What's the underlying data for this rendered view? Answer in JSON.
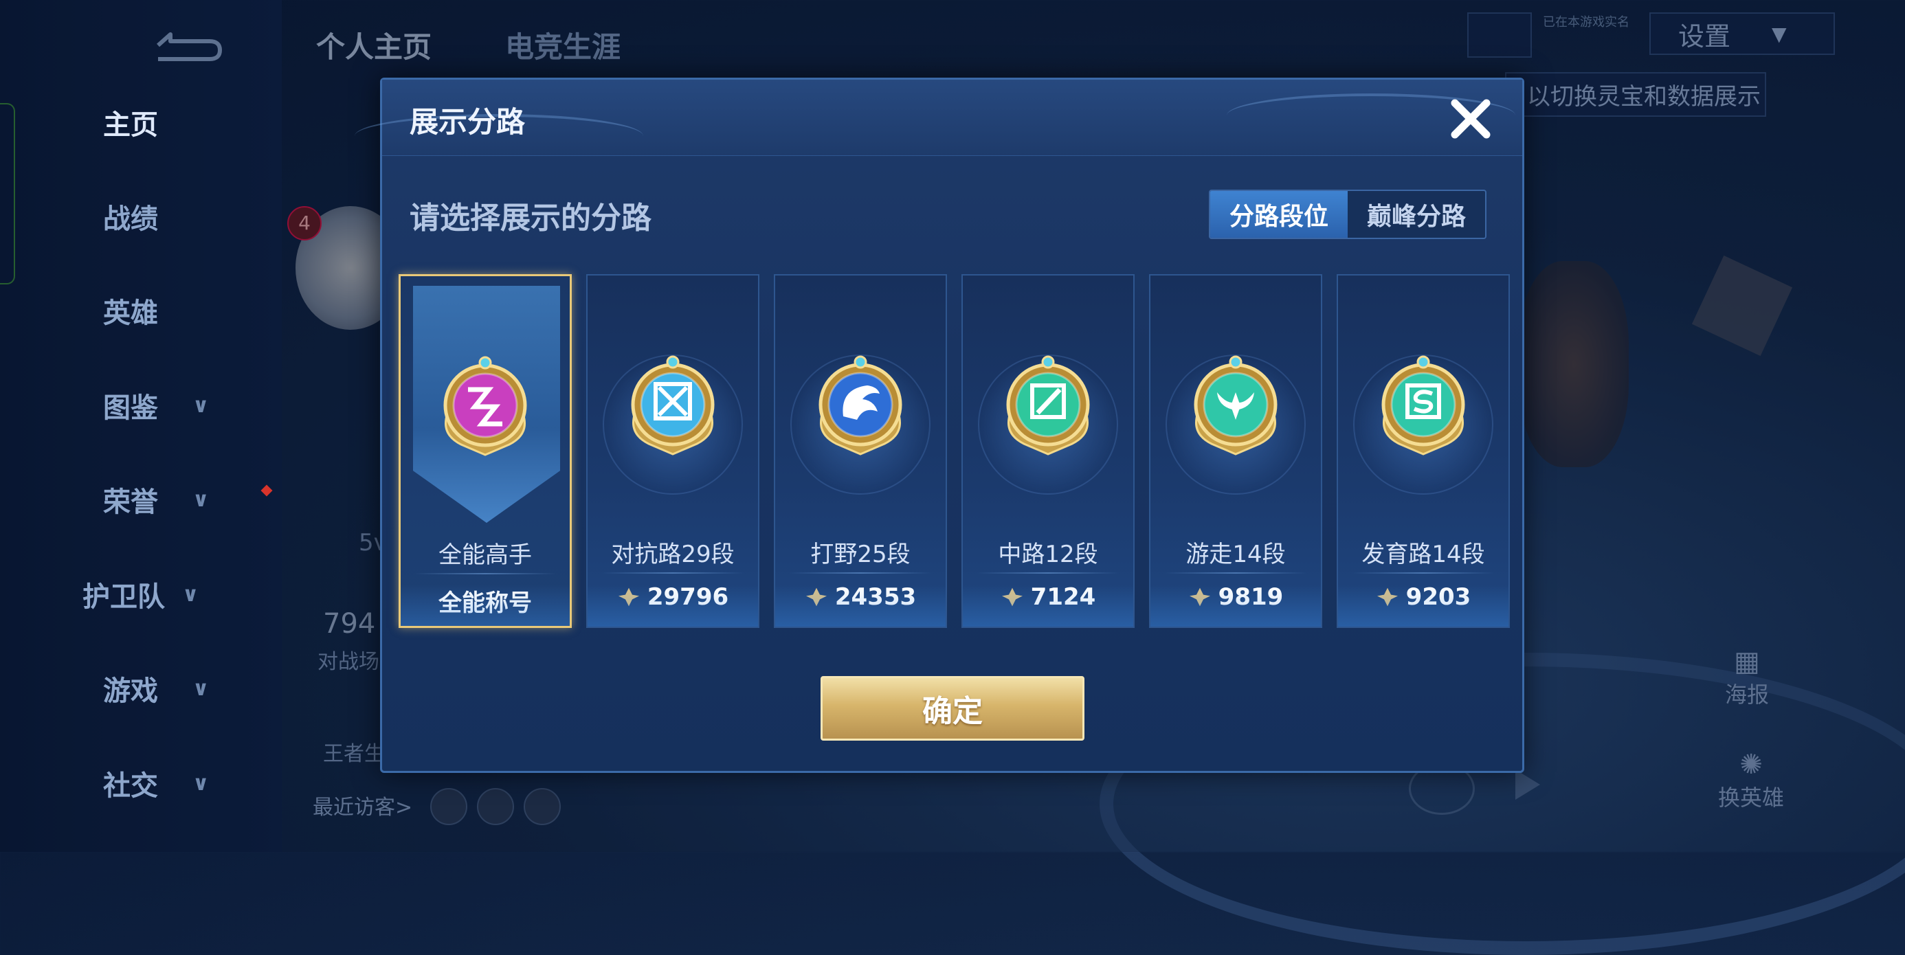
{
  "background": {
    "top_tabs": [
      "个人主页",
      "电竞生涯"
    ],
    "sidebar": [
      {
        "label": "主页",
        "has_arrow": false
      },
      {
        "label": "战绩",
        "has_arrow": false
      },
      {
        "label": "英雄",
        "has_arrow": false
      },
      {
        "label": "图鉴",
        "has_arrow": true
      },
      {
        "label": "荣誉",
        "has_arrow": true
      },
      {
        "label": "护卫队",
        "has_arrow": true
      },
      {
        "label": "游戏",
        "has_arrow": true
      },
      {
        "label": "社交",
        "has_arrow": true
      }
    ],
    "settings_label": "设置",
    "hint_text": "以切换灵宝和数据展示",
    "tiny_note": "已在本游戏实名",
    "badge_count": "4",
    "partial_5v": "5v",
    "partial_number": "794",
    "partial_battle": "对战场",
    "partial_king": "王者生",
    "recent_visitors": "最近访客>",
    "poster": "海报",
    "change_hero": "换英雄"
  },
  "modal": {
    "title": "展示分路",
    "subtitle": "请选择展示的分路",
    "tabs": [
      {
        "label": "分路段位",
        "active": true
      },
      {
        "label": "巅峰分路",
        "active": false
      }
    ],
    "cards": [
      {
        "label": "全能高手",
        "value": "全能称号",
        "has_score_icon": false,
        "selected": true,
        "emblem": "allround-emblem-icon",
        "color": "#c93fbf"
      },
      {
        "label": "对抗路29段",
        "value": "29796",
        "has_score_icon": true,
        "selected": false,
        "emblem": "clash-lane-emblem-icon",
        "color": "#3fb4e8"
      },
      {
        "label": "打野25段",
        "value": "24353",
        "has_score_icon": true,
        "selected": false,
        "emblem": "jungle-emblem-icon",
        "color": "#2e6ed6"
      },
      {
        "label": "中路12段",
        "value": "7124",
        "has_score_icon": true,
        "selected": false,
        "emblem": "mid-lane-emblem-icon",
        "color": "#2fc79c"
      },
      {
        "label": "游走14段",
        "value": "9819",
        "has_score_icon": true,
        "selected": false,
        "emblem": "roam-emblem-icon",
        "color": "#2fc7a8"
      },
      {
        "label": "发育路14段",
        "value": "9203",
        "has_score_icon": true,
        "selected": false,
        "emblem": "farm-lane-emblem-icon",
        "color": "#2fc7a8"
      }
    ],
    "confirm_label": "确定"
  },
  "colors": {
    "gold": "#e9c978",
    "accent_blue": "#3f83d1"
  }
}
